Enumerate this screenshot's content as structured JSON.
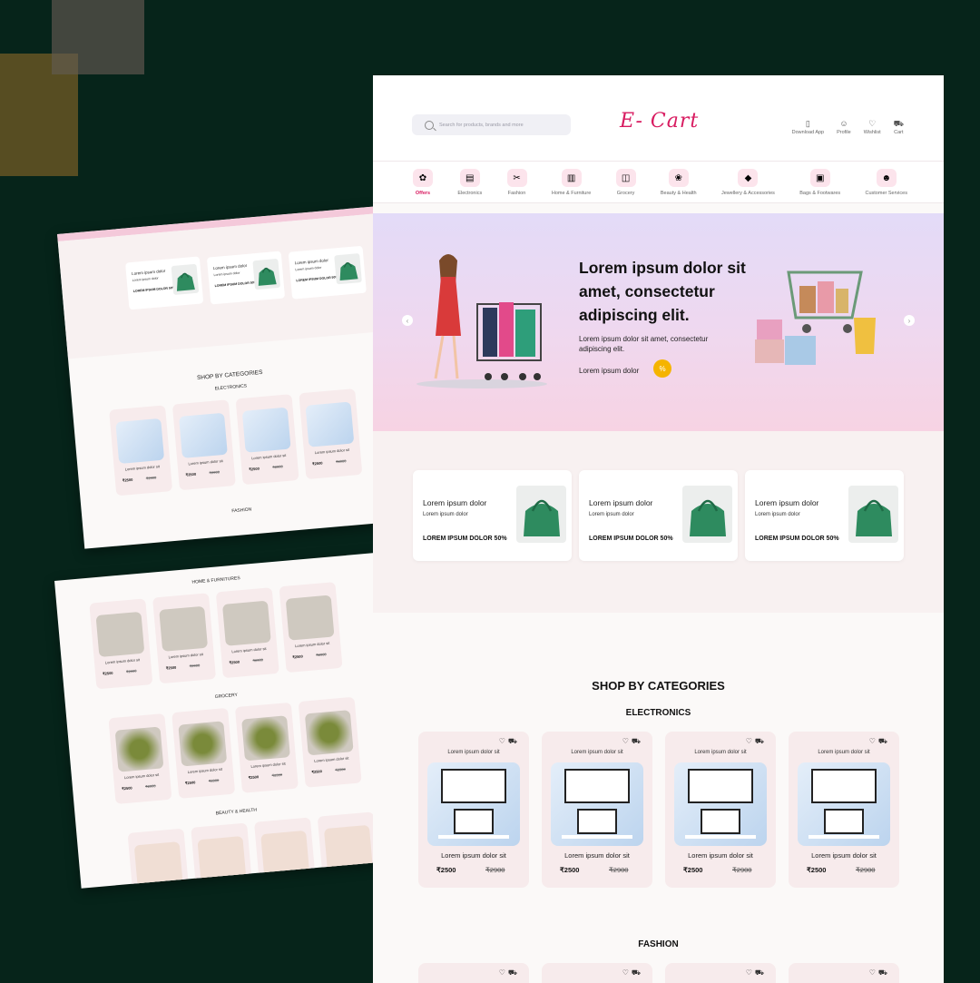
{
  "header": {
    "search_placeholder": "Search for products, brands and more",
    "logo": "E- Cart",
    "nav": [
      "Download App",
      "Profile",
      "Wishlist",
      "Cart"
    ]
  },
  "categories": [
    "Offers",
    "Electronics",
    "Fashion",
    "Home & Furniture",
    "Grocery",
    "Beauty & Health",
    "Jewellery & Accessories",
    "Bags & Footwares",
    "Customer Services"
  ],
  "hero": {
    "headline": "Lorem ipsum dolor sit amet, consectetur adipiscing elit.",
    "sub": "Lorem ipsum dolor sit amet, consectetur adipiscing elit.",
    "cta": "Lorem ipsum dolor",
    "badge": "%"
  },
  "offers": [
    {
      "title": "Lorem ipsum dolor",
      "subtitle": "Lorem ipsum dolor",
      "deal": "LOREM IPSUM DOLOR  50%"
    },
    {
      "title": "Lorem ipsum dolor",
      "subtitle": "Lorem ipsum dolor",
      "deal": "LOREM IPSUM DOLOR  50%"
    },
    {
      "title": "Lorem ipsum dolor",
      "subtitle": "Lorem ipsum dolor",
      "deal": "LOREM IPSUM DOLOR  50%"
    }
  ],
  "shop": {
    "title": "SHOP BY CATEGORIES",
    "electronics": "ELECTRONICS",
    "fashion": "FASHION"
  },
  "products": [
    {
      "tag": "Lorem ipsum dolor sit",
      "name": "Lorem ipsum dolor sit",
      "price": "₹2500",
      "old": "₹2900"
    },
    {
      "tag": "Lorem ipsum dolor sit",
      "name": "Lorem ipsum dolor sit",
      "price": "₹2500",
      "old": "₹2900"
    },
    {
      "tag": "Lorem ipsum dolor sit",
      "name": "Lorem ipsum dolor sit",
      "price": "₹2500",
      "old": "₹2900"
    },
    {
      "tag": "Lorem ipsum dolor sit",
      "name": "Lorem ipsum dolor sit",
      "price": "₹2500",
      "old": "₹2900"
    }
  ],
  "preview1": {
    "offer_title": "Lorem ipsum dolor",
    "offer_sub": "Lorem ipsum dolor",
    "offer_deal": "LOREM IPSUM DOLOR  50%",
    "shop": "SHOP BY CATEGORIES",
    "electronics": "ELECTRONICS",
    "fashion": "FASHION",
    "item": "Lorem ipsum dolor sit",
    "price": "₹2500",
    "old": "₹2900"
  },
  "preview2": {
    "home": "HOME & FURNITURES",
    "grocery": "GROCERY",
    "beauty": "BEAUTY & HEALTH",
    "item": "Lorem ipsum dolor sit",
    "price": "₹2500",
    "old": "₹2900"
  },
  "colors": {
    "accent": "#d81b60",
    "background": "#06241a"
  }
}
